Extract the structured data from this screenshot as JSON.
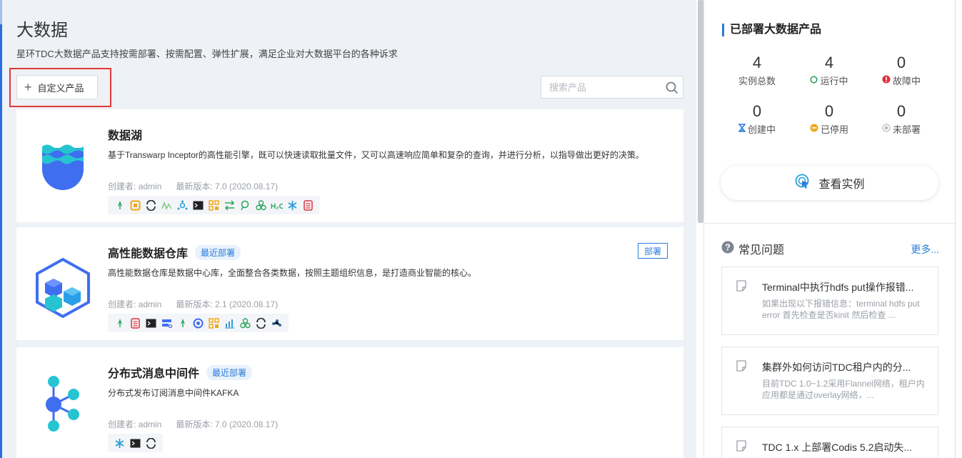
{
  "page": {
    "title": "大数据",
    "subtitle": "星环TDC大数据产品支持按需部署、按需配置、弹性扩展，满足企业对大数据平台的各种诉求"
  },
  "toolbar": {
    "custom_product_label": "自定义产品",
    "search_placeholder": "搜索产品"
  },
  "products": [
    {
      "name": "数据湖",
      "badge": "",
      "description": "基于Transwarp Inceptor的高性能引擎，既可以快速读取批量文件，又可以高速响应简单和复杂的查询，并进行分析，以指导做出更好的决策。",
      "creator": "创建者: admin",
      "version": "最新版本: 7.0 (2020.08.17)"
    },
    {
      "name": "高性能数据仓库",
      "badge": "最近部署",
      "description": "高性能数据仓库是数据中心库，全面整合各类数据，按照主题组织信息，是打造商业智能的核心。",
      "creator": "创建者: admin",
      "version": "最新版本: 2.1 (2020.08.17)",
      "deploy_label": "部署"
    },
    {
      "name": "分布式消息中间件",
      "badge": "最近部署",
      "description": "分布式发布订阅消息中间件KAFKA",
      "creator": "创建者: admin",
      "version": "最新版本: 7.0 (2020.08.17)"
    }
  ],
  "panel": {
    "title": "已部署大数据产品",
    "stats": [
      {
        "value": "4",
        "label": "实例总数"
      },
      {
        "value": "4",
        "label": "运行中"
      },
      {
        "value": "0",
        "label": "故障中"
      },
      {
        "value": "0",
        "label": "创建中"
      },
      {
        "value": "0",
        "label": "已停用"
      },
      {
        "value": "0",
        "label": "未部署"
      }
    ],
    "view_instances_label": "查看实例",
    "faq_title": "常见问题",
    "faq_more": "更多...",
    "faq_items": [
      {
        "title": "Terminal中执行hdfs put操作报错...",
        "desc": "如果出现以下报错信息：terminal hdfs put error 首先检查是否kinit 然后检查 ..."
      },
      {
        "title": "集群外如何访问TDC租户内的分...",
        "desc": "目前TDC 1.0~1.2采用Flannel网络，租户内应用都是通过overlay网络，..."
      },
      {
        "title": "TDC 1.x 上部署Codis 5.2启动失...",
        "desc": ""
      }
    ]
  },
  "colors": {
    "accent": "#2a7bd8",
    "running": "#2ca45c",
    "fault": "#e0303a",
    "creating": "#2a7bd8",
    "stopped": "#f0a81a",
    "undeployed": "#b8bcc2",
    "highlight": "#e23a3a"
  }
}
